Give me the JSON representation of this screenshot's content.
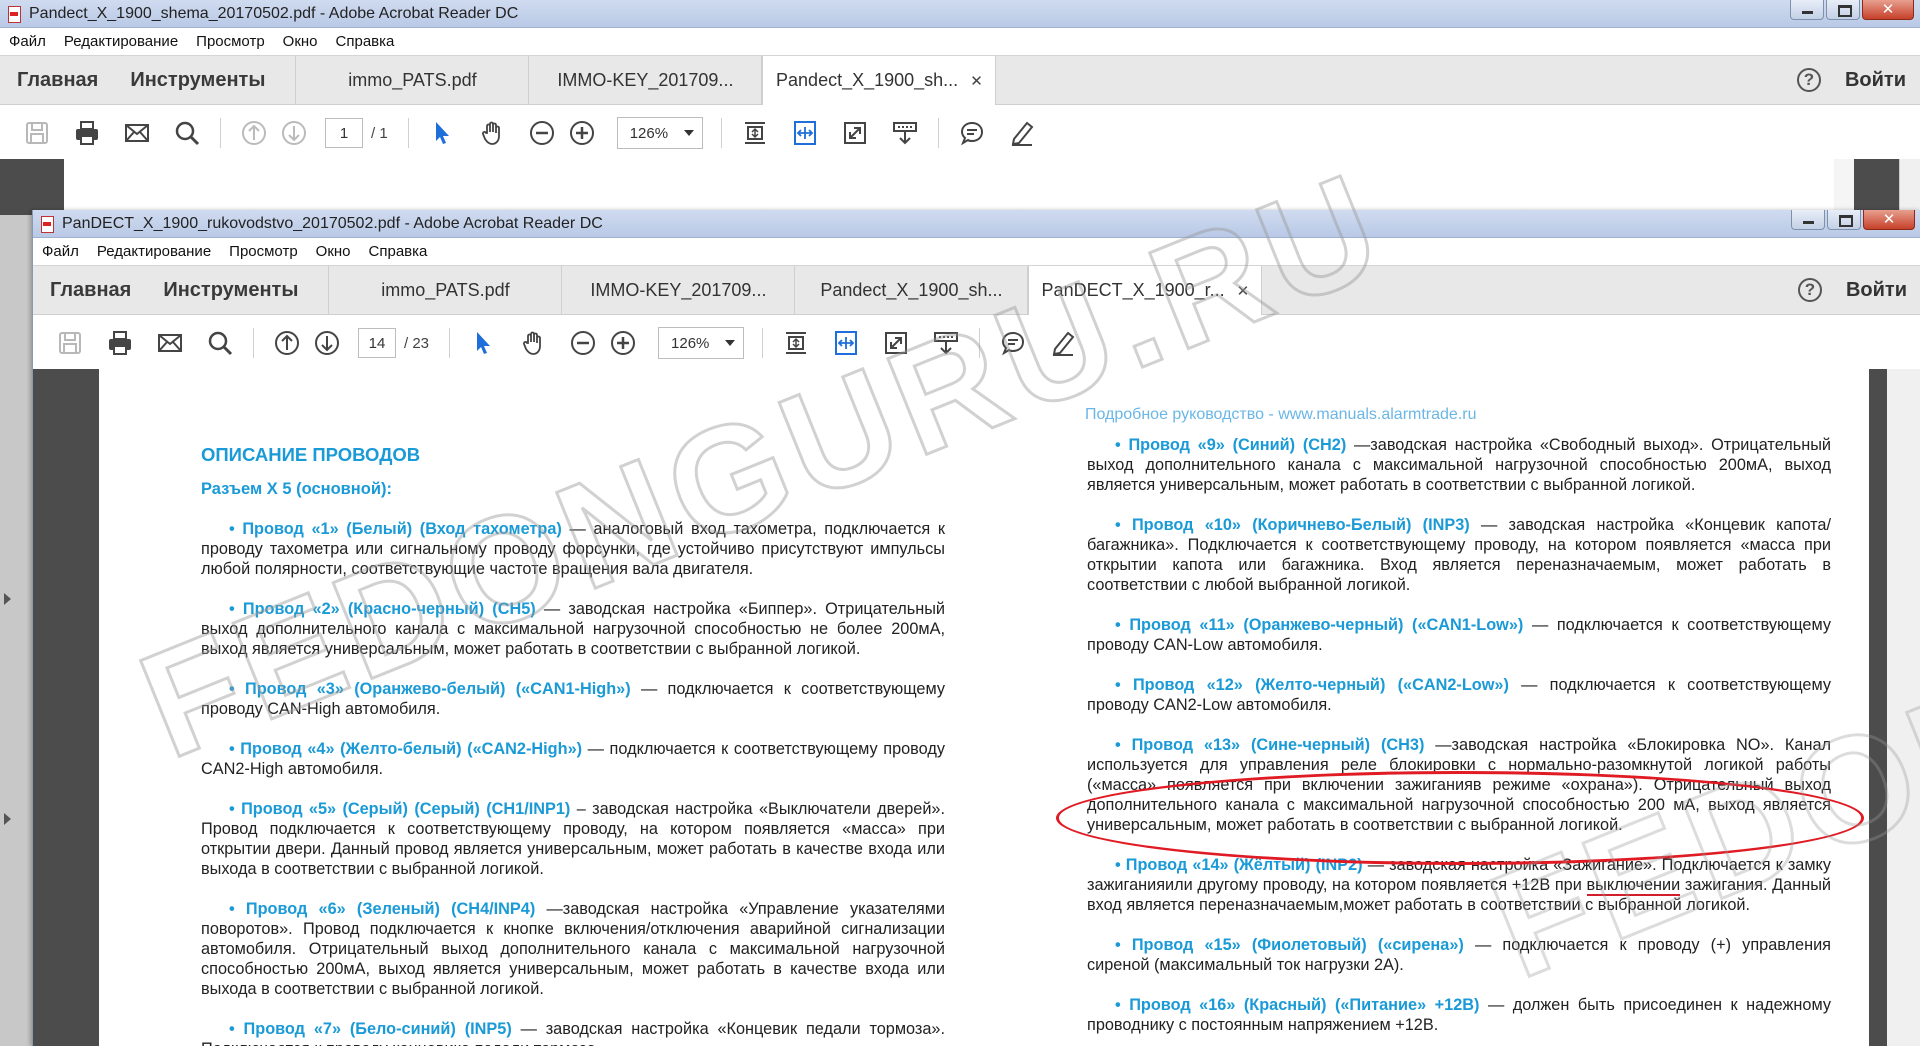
{
  "window_back": {
    "title": "Pandect_X_1900_shema_20170502.pdf - Adobe Acrobat Reader DC",
    "menu": [
      "Файл",
      "Редактирование",
      "Просмотр",
      "Окно",
      "Справка"
    ],
    "nav": [
      "Главная",
      "Инструменты"
    ],
    "tabs": [
      {
        "label": "immo_PATS.pdf",
        "active": false
      },
      {
        "label": "IMMO-KEY_201709...",
        "active": false
      },
      {
        "label": "Pandect_X_1900_sh...",
        "active": true
      }
    ],
    "close_glyph": "✕",
    "help_label": "?",
    "signin_label": "Войти",
    "page_current": "1",
    "page_total": "/ 1",
    "zoom": "126%"
  },
  "window_front": {
    "title": "PanDECT_X_1900_rukovodstvo_20170502.pdf - Adobe Acrobat Reader DC",
    "menu": [
      "Файл",
      "Редактирование",
      "Просмотр",
      "Окно",
      "Справка"
    ],
    "nav": [
      "Главная",
      "Инструменты"
    ],
    "tabs": [
      {
        "label": "immo_PATS.pdf",
        "active": false
      },
      {
        "label": "IMMO-KEY_201709...",
        "active": false
      },
      {
        "label": "Pandect_X_1900_sh...",
        "active": false
      },
      {
        "label": "PanDECT_X_1900_r...",
        "active": true
      }
    ],
    "close_glyph": "✕",
    "help_label": "?",
    "signin_label": "Войти",
    "page_current": "14",
    "page_total": "/ 23",
    "zoom": "126%"
  },
  "document": {
    "running_head": "Подробное руководство - www.manuals.alarmtrade.ru",
    "heading": "ОПИСАНИЕ ПРОВОДОВ",
    "subheading": "Разъем X 5  (основной):",
    "left": [
      {
        "k": "• Провод «1» (Белый) (Вход тахометра)",
        "t": " — аналоговый вход тахометра, подключается к проводу тахометра или сигнальному проводу форсунки, где устойчиво присутствуют импульсы любой полярности, соответствующие частоте вращения вала двигателя."
      },
      {
        "k": "• Провод «2» (Красно-черный) (CH5)",
        "t": " — заводская настройка «Биппер». Отрицательный выход дополнительного канала с максимальной нагрузочной способностью не более 200мА, выход является универсальным, может работать в соответствии с выбранной логикой."
      },
      {
        "k": "• Провод «3» (Оранжево-белый) («CAN1-High»)",
        "t": " — подключается к соответствующему проводу CAN-High автомобиля."
      },
      {
        "k": "• Провод «4» (Желто-белый) («CAN2-High»)",
        "t": " — подключается к соответствующему проводу CAN2-High автомобиля."
      },
      {
        "k": "• Провод «5» (Серый) (Серый) (CH1/INP1)",
        "t": " – заводская настройка «Выключатели дверей». Провод подключается к соответствующему проводу, на котором появляется «масса» при открытии двери. Данный провод является универсальным, может работать в качестве входа или выхода в соответствии с выбранной логикой."
      },
      {
        "k": "• Провод «6» (Зеленый) (CH4/INP4)",
        "t": " —заводская настройка «Управление указателями поворотов». Провод подключается к кнопке включения/отключения аварийной сигнализации автомобиля. Отрицательный выход дополнительного канала с максимальной нагрузочной способностью 200мА, выход является универсальным, может работать в качестве входа или выхода в соответствии с выбранной логикой."
      },
      {
        "k": "• Провод «7» (Бело-синий) (INP5)",
        "t": " — заводская настройка «Концевик педали тормоза». Подключается к проводу концевика педали тормоза."
      }
    ],
    "right": [
      {
        "k": "• Провод «9» (Синий) (CH2)",
        "t": " —заводская настройка «Свободный выход». Отрицательный выход дополнительного канала с максимальной нагрузочной способностью 200мА, выход является универсальным, может работать в соответствии с выбранной логикой."
      },
      {
        "k": "• Провод «10» (Коричнево-Белый) (INP3)",
        "t": " — заводская настройка «Концевик капота/багажника». Подключается к соответствующему проводу, на котором появляется «масса при открытии капота или багажника. Вход является переназначаемым, может работать в соответствии с любой выбранной логикой."
      },
      {
        "k": "• Провод «11» (Оранжево-черный) («CAN1-Low»)",
        "t": " — подключается к соответствующему проводу CAN-Low автомобиля."
      },
      {
        "k": "• Провод «12» (Желто-черный) («CAN2-Low»)",
        "t": " — подключается к соответствующему проводу CAN2-Low автомобиля."
      },
      {
        "k": "• Провод «13» (Сине-черный) (CH3)",
        "t": " —заводская настройка «Блокировка NO». Канал используется для управления реле блокировки с нормально-разомкнутой логикой работы («масса» появляется при включении зажиганияв режиме «охрана»). Отрицательный выход дополнительного канала с максимальной нагрузочной способностью 200 мА, выход является универсальным, может работать в соответствии с выбранной логикой."
      },
      {
        "k": "• Провод «14» (Жёлтый) (INP2)",
        "t1": " — заводская настройка «Зажигание». Подключается к замку зажиганияили другому проводу, на котором появляется +12В при ",
        "u": "выключении",
        "t2": " зажигания. Данный вход является переназначаемым,может работать в соответствии с выбранной логикой."
      },
      {
        "k": "• Провод «15» (Фиолетовый) («сирена»)",
        "t": " — подключается к проводу (+) управления сиреной (максимальный ток нагрузки 2А)."
      },
      {
        "k": "• Провод «16» (Красный) («Питание» +12В)",
        "t": " — должен быть присоединен к надежному проводнику с постоянным напряжением +12В."
      }
    ]
  },
  "watermark": "FEDONGURU.RU",
  "colors": {
    "accent_blue": "#1a9ad6",
    "annotation_red": "#e01b24",
    "doc_bg": "#4c4c4c",
    "tool_blue": "#1e6fd9"
  }
}
